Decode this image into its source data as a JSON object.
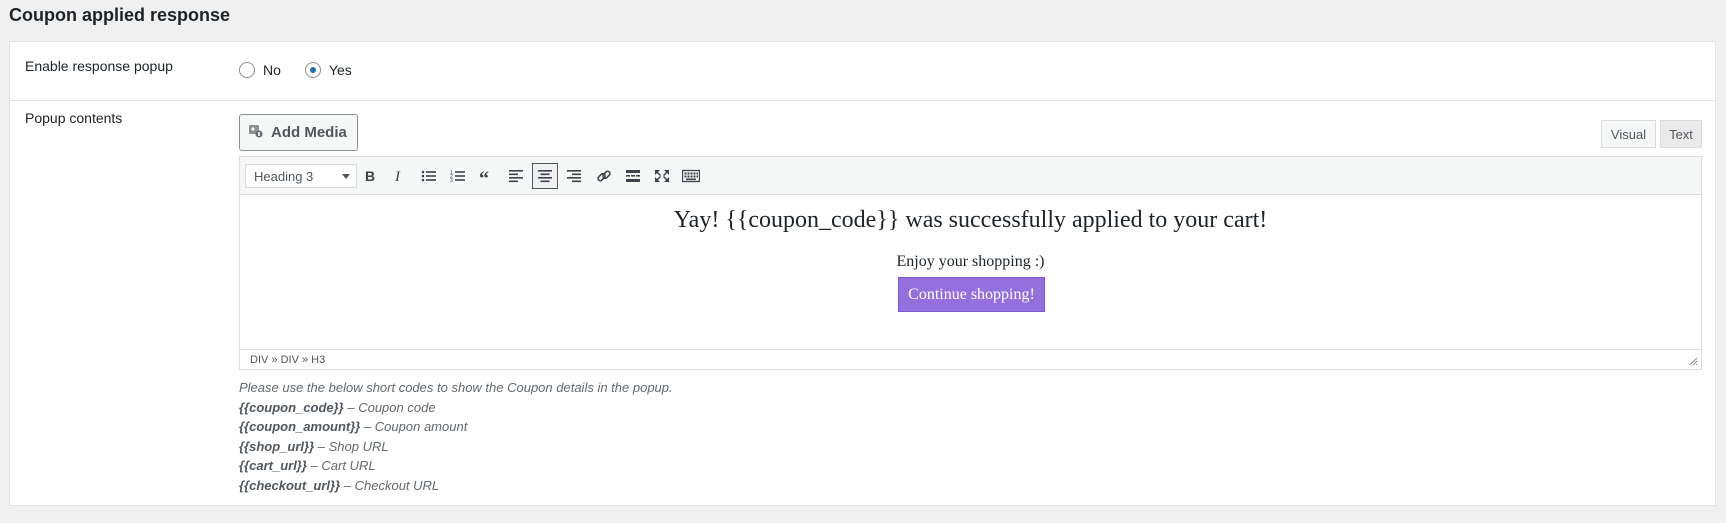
{
  "section_title": "Coupon applied response",
  "enable_popup": {
    "label": "Enable response popup",
    "options": [
      {
        "label": "No",
        "checked": false
      },
      {
        "label": "Yes",
        "checked": true
      }
    ]
  },
  "popup_contents": {
    "label": "Popup contents",
    "add_media_label": "Add Media",
    "tabs": {
      "visual": "Visual",
      "text": "Text"
    },
    "format_value": "Heading 3",
    "toolbar_icons": [
      "bold-icon",
      "italic-icon",
      "bullet-list-icon",
      "numbered-list-icon",
      "blockquote-icon",
      "align-left-icon",
      "align-center-icon",
      "align-right-icon",
      "link-icon",
      "read-more-icon",
      "fullscreen-icon",
      "toolbar-toggle-icon"
    ],
    "content": {
      "heading": "Yay! {{coupon_code}} was successfully applied to your cart!",
      "subtext": "Enjoy your shopping :)",
      "button": "Continue shopping!",
      "button_color": "#9370db"
    },
    "path": "DIV » DIV » H3"
  },
  "help": {
    "intro": "Please use the below short codes to show the Coupon details in the popup.",
    "codes": [
      {
        "code": "{{coupon_code}}",
        "desc": " – Coupon code"
      },
      {
        "code": "{{coupon_amount}}",
        "desc": " – Coupon amount"
      },
      {
        "code": "{{shop_url}}",
        "desc": " – Shop URL"
      },
      {
        "code": "{{cart_url}}",
        "desc": " – Cart URL"
      },
      {
        "code": "{{checkout_url}}",
        "desc": " – Checkout URL"
      }
    ]
  }
}
